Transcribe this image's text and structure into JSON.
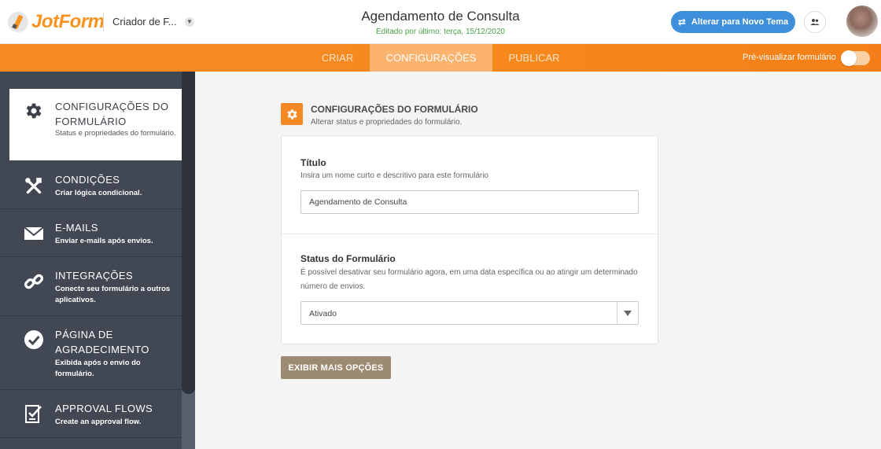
{
  "header": {
    "logo_text": "JotForm",
    "builder_label": "Criador de F...",
    "form_title": "Agendamento de Consulta",
    "edited_text": "Editado por último: terça, 15/12/2020",
    "theme_button_label": "Alterar para Novo Tema"
  },
  "nav": {
    "tabs": [
      {
        "label": "CRIAR"
      },
      {
        "label": "CONFIGURAÇÕES"
      },
      {
        "label": "PUBLICAR"
      }
    ],
    "preview_label": "Pré-visualizar formulário",
    "preview_enabled": false
  },
  "sidebar": {
    "items": [
      {
        "title": "CONFIGURAÇÕES DO FORMULÁRIO",
        "desc": "Status e propriedades do formulário.",
        "icon": "gear-icon",
        "active": true
      },
      {
        "title": "CONDIÇÕES",
        "desc": "Criar lógica condicional.",
        "icon": "tools-icon"
      },
      {
        "title": "E-MAILS",
        "desc": "Enviar e-mails após envios.",
        "icon": "envelope-icon"
      },
      {
        "title": "INTEGRAÇÕES",
        "desc": "Conecte seu formulário a outros aplicativos.",
        "icon": "link-icon"
      },
      {
        "title": "PÁGINA DE AGRADECIMENTO",
        "desc": "Exibida após o envio do formulário.",
        "icon": "check-circle-icon"
      },
      {
        "title": "APPROVAL FLOWS",
        "desc": "Create an approval flow.",
        "icon": "approval-icon"
      }
    ]
  },
  "main": {
    "section_title": "CONFIGURAÇÕES DO FORMULÁRIO",
    "section_subtitle": "Alterar status e propriedades do formulário.",
    "title_field": {
      "label": "Título",
      "help": "Insira um nome curto e descritivo para este formulário",
      "value": "Agendamento de Consulta"
    },
    "status_field": {
      "label": "Status do Formulário",
      "help": "É possível desativar seu formulário agora, em uma data específica ou ao atingir um determinado número de envios.",
      "value": "Ativado"
    },
    "more_options_label": "EXIBIR MAIS OPÇÕES"
  },
  "colors": {
    "accent": "#f58a24",
    "theme_button": "#3d8fdb",
    "sidebar_bg": "#414753",
    "more_button": "#9c8a72",
    "edited_text": "#4aa24a"
  }
}
